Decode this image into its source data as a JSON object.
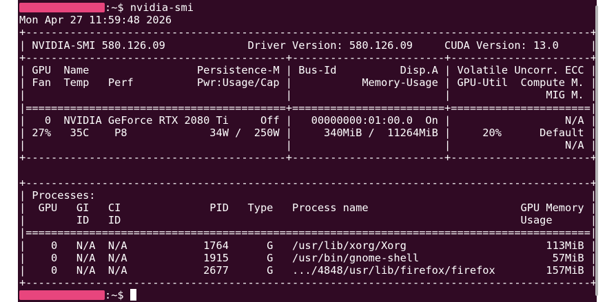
{
  "theme": {
    "background": "#300a24",
    "foreground": "#ffffff",
    "redaction": "#e8457d"
  },
  "prompt": {
    "suffix": ":~$ ",
    "command": "nvidia-smi"
  },
  "lines": [
    "Mon Apr 27 11:59:48 2026",
    "+-----------------------------------------------------------------------------------------+",
    "| NVIDIA-SMI 580.126.09             Driver Version: 580.126.09     CUDA Version: 13.0     |",
    "+-----------------------------------------+------------------------+----------------------+",
    "| GPU  Name                 Persistence-M | Bus-Id          Disp.A | Volatile Uncorr. ECC |",
    "| Fan  Temp   Perf          Pwr:Usage/Cap |           Memory-Usage | GPU-Util  Compute M. |",
    "|                                         |                        |               MIG M. |",
    "|=========================================+========================+======================|",
    "|   0  NVIDIA GeForce RTX 2080 Ti     Off |   00000000:01:00.0  On |                  N/A |",
    "| 27%   35C    P8             34W /  250W |     340MiB /  11264MiB |     20%      Default |",
    "|                                         |                        |                  N/A |",
    "+-----------------------------------------+------------------------+----------------------+",
    "",
    "+-----------------------------------------------------------------------------------------+",
    "| Processes:                                                                              |",
    "|  GPU   GI   CI              PID   Type   Process name                        GPU Memory |",
    "|        ID   ID                                                               Usage      |",
    "|=========================================================================================|",
    "|    0   N/A  N/A            1764      G   /usr/lib/xorg/Xorg                      113MiB |",
    "|    0   N/A  N/A            1915      G   /usr/bin/gnome-shell                     57MiB |",
    "|    0   N/A  N/A            2677      G   .../4848/usr/lib/firefox/firefox        157MiB |",
    "+-----------------------------------------------------------------------------------------+"
  ]
}
